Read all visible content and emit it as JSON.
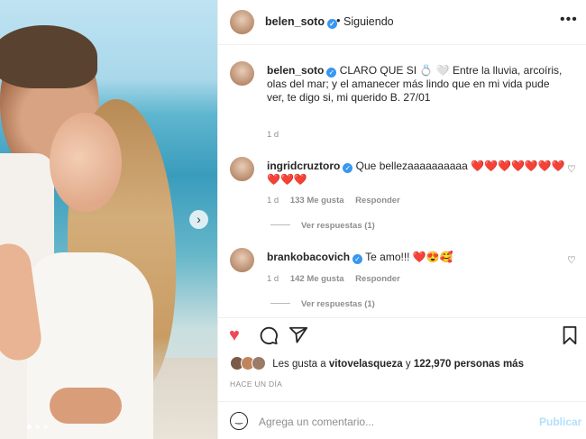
{
  "header": {
    "username": "belen_soto",
    "separator": "•",
    "follow_status": "Siguiendo",
    "more": "•••"
  },
  "caption": {
    "username": "belen_soto",
    "text": "CLARO QUE SI 💍 🤍 Entre la lluvia, arcoíris, olas del mar; y el amanecer más lindo que en mi vida pude ver, te digo si, mi querido B. 27/01",
    "time": "1 d"
  },
  "comments": [
    {
      "username": "ingridcruztoro",
      "text": "Que bellezaaaaaaaaaa",
      "emoji": "❤️❤️❤️❤️❤️❤️❤️❤️❤️❤️",
      "time": "1 d",
      "likes": "133 Me gusta",
      "reply": "Responder",
      "view_replies": "Ver respuestas (1)"
    },
    {
      "username": "brankobacovich",
      "text": "Te amo!!!",
      "emoji": "❤️😍🥰",
      "time": "1 d",
      "likes": "142 Me gusta",
      "reply": "Responder",
      "view_replies": "Ver respuestas (1)"
    }
  ],
  "icons": {
    "like": "heart-icon",
    "comment": "comment-icon",
    "share": "share-icon",
    "save": "bookmark-icon",
    "next": "chevron-right-icon",
    "emoji": "emoji-icon"
  },
  "likes_line": {
    "prefix": "Les gusta a",
    "user": "vitovelasqueza",
    "connector": "y",
    "count": "122,970 personas más"
  },
  "posted_ago": "HACE UN DÍA",
  "composer": {
    "placeholder": "Agrega un comentario...",
    "post_label": "Publicar"
  },
  "carousel": {
    "current": 1,
    "total": 3
  },
  "colors": {
    "like": "#ed4956",
    "verified": "#3897f0",
    "post_disabled": "#b2dffc"
  }
}
